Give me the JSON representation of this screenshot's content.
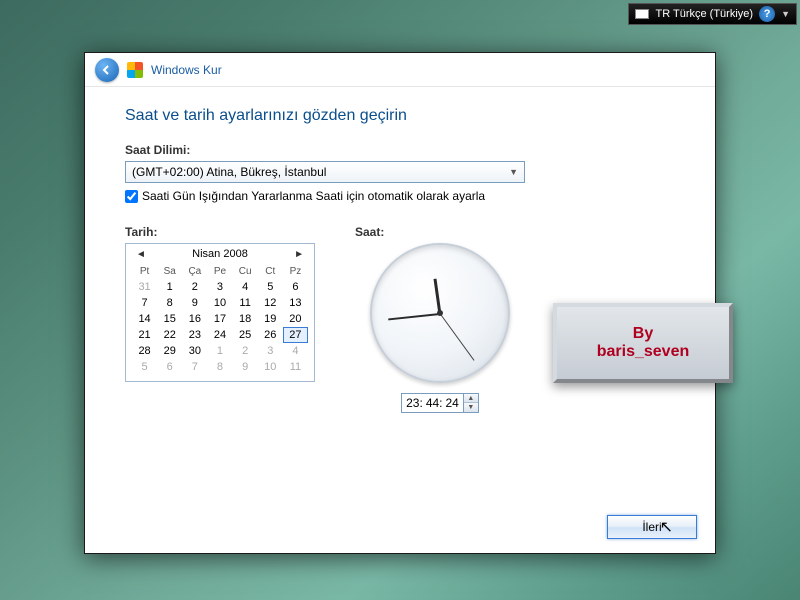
{
  "topbar": {
    "lang": "TR Türkçe (Türkiye)",
    "help": "?"
  },
  "wizard": {
    "title": "Windows Kur",
    "heading": "Saat ve tarih ayarlarınızı gözden geçirin",
    "tz_label": "Saat Dilimi:",
    "tz_value": "(GMT+02:00) Atina, Bükreş, İstanbul",
    "dst_label": "Saati Gün Işığından Yararlanma Saati için otomatik olarak ayarla",
    "date_label": "Tarih:",
    "time_label": "Saat:",
    "next": "İleri"
  },
  "calendar": {
    "month": "Nisan 2008",
    "days_header": [
      "Pt",
      "Sa",
      "Ça",
      "Pe",
      "Cu",
      "Ct",
      "Pz"
    ],
    "cells": [
      {
        "v": "31",
        "o": true
      },
      {
        "v": "1"
      },
      {
        "v": "2"
      },
      {
        "v": "3"
      },
      {
        "v": "4"
      },
      {
        "v": "5"
      },
      {
        "v": "6"
      },
      {
        "v": "7"
      },
      {
        "v": "8"
      },
      {
        "v": "9"
      },
      {
        "v": "10"
      },
      {
        "v": "11"
      },
      {
        "v": "12"
      },
      {
        "v": "13"
      },
      {
        "v": "14"
      },
      {
        "v": "15"
      },
      {
        "v": "16"
      },
      {
        "v": "17"
      },
      {
        "v": "18"
      },
      {
        "v": "19"
      },
      {
        "v": "20"
      },
      {
        "v": "21"
      },
      {
        "v": "22"
      },
      {
        "v": "23"
      },
      {
        "v": "24"
      },
      {
        "v": "25"
      },
      {
        "v": "26"
      },
      {
        "v": "27",
        "s": true
      },
      {
        "v": "28"
      },
      {
        "v": "29"
      },
      {
        "v": "30"
      },
      {
        "v": "1",
        "o": true
      },
      {
        "v": "2",
        "o": true
      },
      {
        "v": "3",
        "o": true
      },
      {
        "v": "4",
        "o": true
      },
      {
        "v": "5",
        "o": true
      },
      {
        "v": "6",
        "o": true
      },
      {
        "v": "7",
        "o": true
      },
      {
        "v": "8",
        "o": true
      },
      {
        "v": "9",
        "o": true
      },
      {
        "v": "10",
        "o": true
      },
      {
        "v": "11",
        "o": true
      }
    ]
  },
  "time": {
    "h": "23:",
    "m": "44:",
    "s": "24"
  },
  "watermark": {
    "l1": "By",
    "l2": "baris_seven"
  }
}
